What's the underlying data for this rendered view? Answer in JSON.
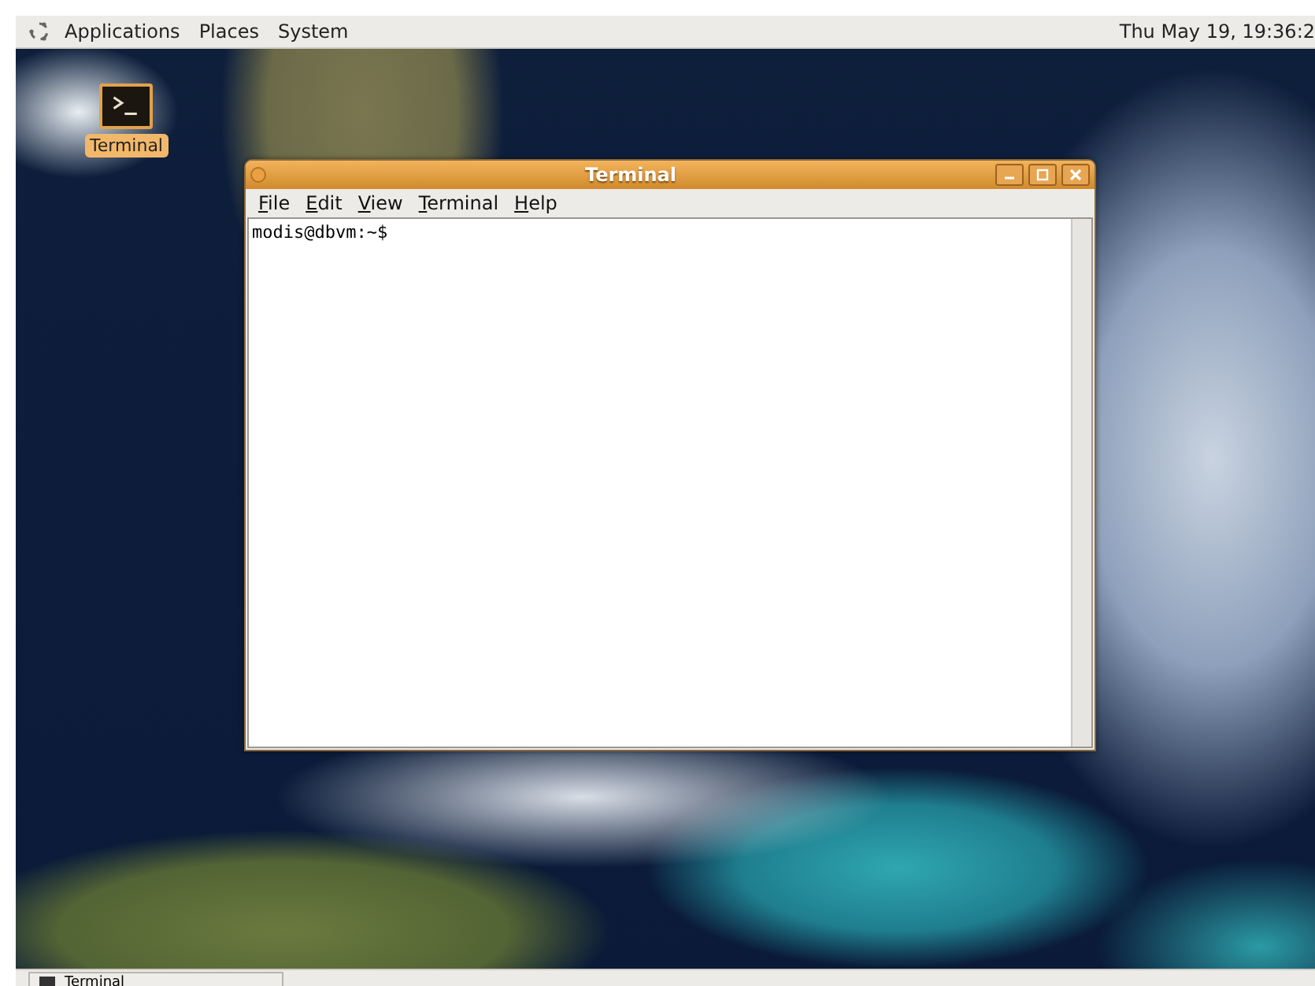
{
  "top_panel": {
    "menus": [
      "Applications",
      "Places",
      "System"
    ],
    "clock": "Thu May 19, 19:36:2"
  },
  "desktop_icons": [
    {
      "label": "Terminal",
      "selected": true
    }
  ],
  "window": {
    "title": "Terminal",
    "menu": [
      "File",
      "Edit",
      "View",
      "Terminal",
      "Help"
    ],
    "prompt": "modis@dbvm:~$"
  },
  "taskbar": {
    "buttons": [
      {
        "label": "Terminal"
      }
    ]
  }
}
